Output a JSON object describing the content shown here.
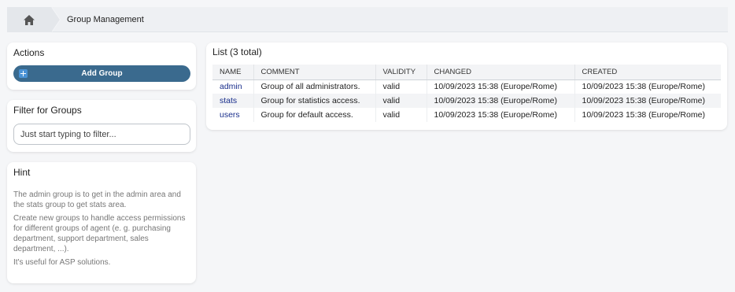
{
  "breadcrumb": {
    "home_icon": "home-icon",
    "current": "Group Management"
  },
  "actions": {
    "title": "Actions",
    "add_group_label": "Add Group",
    "add_icon": "plus-square-icon"
  },
  "filter": {
    "title": "Filter for Groups",
    "placeholder": "Just start typing to filter..."
  },
  "hint": {
    "title": "Hint",
    "paragraphs": [
      "The admin group is to get in the admin area and the stats group to get stats area.",
      "Create new groups to handle access permissions for different groups of agent (e. g. purchasing department, support department, sales department, ...).",
      "It's useful for ASP solutions."
    ]
  },
  "list": {
    "title": "List (3 total)",
    "columns": [
      "NAME",
      "COMMENT",
      "VALIDITY",
      "CHANGED",
      "CREATED"
    ],
    "rows": [
      {
        "name": "admin",
        "comment": "Group of all administrators.",
        "validity": "valid",
        "changed": "10/09/2023 15:38 (Europe/Rome)",
        "created": "10/09/2023 15:38 (Europe/Rome)"
      },
      {
        "name": "stats",
        "comment": "Group for statistics access.",
        "validity": "valid",
        "changed": "10/09/2023 15:38 (Europe/Rome)",
        "created": "10/09/2023 15:38 (Europe/Rome)"
      },
      {
        "name": "users",
        "comment": "Group for default access.",
        "validity": "valid",
        "changed": "10/09/2023 15:38 (Europe/Rome)",
        "created": "10/09/2023 15:38 (Europe/Rome)"
      }
    ]
  },
  "colors": {
    "button": "#3a6a8e",
    "link": "#1a2f8c",
    "background": "#f5f6f8"
  }
}
